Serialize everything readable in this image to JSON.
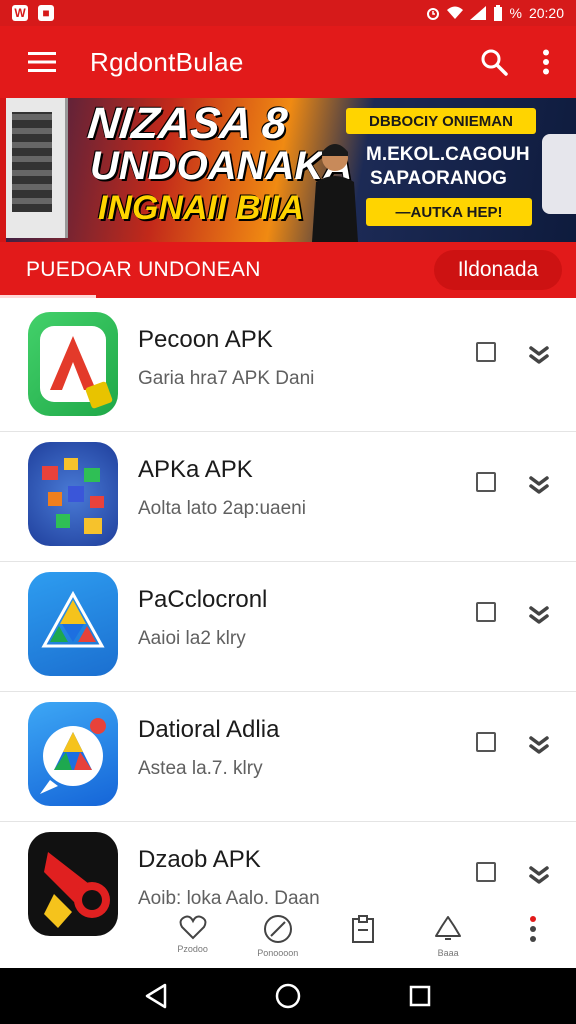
{
  "status_bar": {
    "left_icons": [
      "W",
      "notification-icon"
    ],
    "time": "20:20",
    "battery_pct": "%",
    "icons": [
      "alarm-icon",
      "wifi-icon",
      "signal-icon",
      "battery-icon"
    ]
  },
  "app_bar": {
    "title": "RgdontBulae",
    "menu_icon": "menu-icon",
    "search_icon": "search-icon",
    "more_icon": "more-vert-icon"
  },
  "banner": {
    "headline_1": "NIZASA 8",
    "headline_2": "UNDOANAKA",
    "headline_3": "INGNAII BIIA",
    "pill_top": "DBBOCIY ONIEMAN",
    "line_1": "M.EKOL.CAGOUH",
    "line_2": "SAPAORANOG",
    "pill_bottom": "—AUTKA HEP!"
  },
  "section": {
    "label": "PUEDOAR UNDONEAN",
    "chip": "Ildonada"
  },
  "apps": [
    {
      "name": "Pecoon APK",
      "subtitle": "Garia hra7 APK Dani",
      "icon": "red-triangle-app-icon"
    },
    {
      "name": "APKa APK",
      "subtitle": "Aolta lato 2ap:uaeni",
      "icon": "blocks-game-app-icon"
    },
    {
      "name": "PaCclocronl",
      "subtitle": "Aaioi la2 klry",
      "icon": "drive-triangle-app-icon"
    },
    {
      "name": "Datioral Adlia",
      "subtitle": "Astea la.7. klry",
      "icon": "chat-bubble-app-icon"
    },
    {
      "name": "Dzaob APK",
      "subtitle": "Aoib: loka Aalo. Daan",
      "icon": "horn-app-icon"
    }
  ],
  "bottom_nav": [
    {
      "label": "Pzodoo",
      "icon": "heart-icon"
    },
    {
      "label": "Ponoooon",
      "icon": "compass-icon"
    },
    {
      "label": "",
      "icon": "clipboard-icon"
    },
    {
      "label": "Baaa",
      "icon": "bell-icon"
    },
    {
      "label": "",
      "icon": "overflow-icon"
    }
  ],
  "system_nav": [
    "back-icon",
    "home-icon",
    "recents-icon"
  ],
  "colors": {
    "primary": "#e21a1a",
    "accent": "#ffd400"
  }
}
